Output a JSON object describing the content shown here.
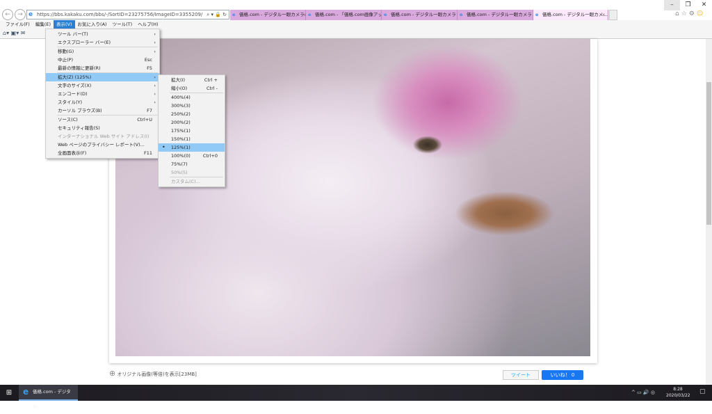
{
  "browser": {
    "url": "https://bbs.kakaku.com/bbs/-/SortID=23275756/ImageID=3355209/",
    "tabs": [
      "価格.com - デジタル一眼カメラの...",
      "価格.com - 「価格.com画像アッ...",
      "価格.com - デジタル一眼カメラ 評...",
      "価格.com - デジタル一眼カメラ 評...",
      "価格.com - デジタル一眼カメ..."
    ],
    "tab_close": "×"
  },
  "menubar": [
    "ファイル(F)",
    "編集(E)",
    "表示(V)",
    "お気に入り(A)",
    "ツール(T)",
    "ヘルプ(H)"
  ],
  "view_menu": [
    {
      "label": "ツール バー(T)",
      "arrow": "›"
    },
    {
      "label": "エクスプローラー バー(E)",
      "arrow": "›"
    },
    {
      "label": "移動(G)",
      "arrow": "›"
    },
    {
      "label": "中止(P)",
      "key": "Esc"
    },
    {
      "label": "最新の情報に更新(R)",
      "key": "F5"
    },
    {
      "label": "拡大(Z) (125%)",
      "arrow": "›"
    },
    {
      "label": "文字のサイズ(X)",
      "arrow": "›"
    },
    {
      "label": "エンコード(D)",
      "arrow": "›"
    },
    {
      "label": "スタイル(Y)",
      "arrow": "›"
    },
    {
      "label": "カーソル ブラウズ(B)",
      "key": "F7"
    },
    {
      "label": "ソース(C)",
      "key": "Ctrl+U"
    },
    {
      "label": "セキュリティ報告(S)"
    },
    {
      "label": "インターナショナル Web サイト アドレス(I)"
    },
    {
      "label": "Web ページのプライバシー レポート(V)..."
    },
    {
      "label": "全画面表示(F)",
      "key": "F11"
    }
  ],
  "zoom_menu": [
    {
      "label": "拡大(I)",
      "key": "Ctrl +"
    },
    {
      "label": "縮小(O)",
      "key": "Ctrl -"
    },
    {
      "label": "400%(4)"
    },
    {
      "label": "300%(3)"
    },
    {
      "label": "250%(2)"
    },
    {
      "label": "200%(2)"
    },
    {
      "label": "175%(1)"
    },
    {
      "label": "150%(1)"
    },
    {
      "label": "125%(1)",
      "selected": "•"
    },
    {
      "label": "100%(0)",
      "key": "Ctrl+0"
    },
    {
      "label": "75%(7)"
    },
    {
      "label": "50%(5)"
    },
    {
      "label": "カスタム(C)..."
    }
  ],
  "page": {
    "original_link": "オリジナル画像(等倍)を表示[23MB]",
    "tweet": "ツイート",
    "like": "いいね！ 0"
  },
  "taskbar": {
    "app": "価格.com - デジタル...",
    "time": "8:28",
    "date": "2020/03/22"
  }
}
